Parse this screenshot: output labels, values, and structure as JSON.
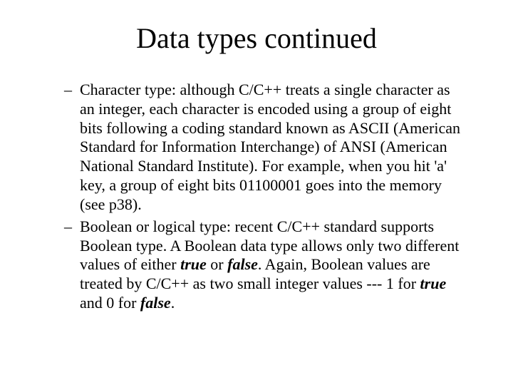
{
  "title": "Data types continued",
  "bullets": [
    {
      "pre": "Character type: although C/C++ treats a single character as an integer, each character is encoded using a group of eight bits following a coding standard known as ASCII (American Standard for Information Interchange) of ANSI (American National Standard Institute). For example, when you hit 'a' key, a group of eight bits 01100001 goes into the memory (see p38)."
    },
    {
      "pre": "Boolean or logical type: recent C/C++ standard supports Boolean type. A Boolean data type allows only two different values of either ",
      "bi1": "true",
      "mid1": " or ",
      "bi2": "false",
      "mid2": ". Again, Boolean values are treated by C/C++ as two small integer values --- 1 for ",
      "bi3": "true",
      "mid3": " and 0 for ",
      "bi4": "false",
      "post": "."
    }
  ]
}
